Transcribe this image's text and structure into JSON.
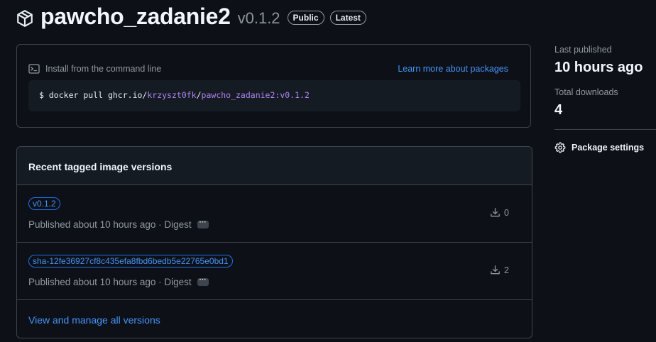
{
  "header": {
    "package_name": "pawcho_zadanie2",
    "version": "v0.1.2",
    "badges": [
      "Public",
      "Latest"
    ]
  },
  "install": {
    "title": "Install from the command line",
    "learn_more": "Learn more about packages",
    "prompt": "$",
    "cmd_prefix": "docker pull ghcr.io/",
    "cmd_owner": "krzyszt0fk",
    "cmd_sep": "/",
    "cmd_image": "pawcho_zadanie2:v0.1.2"
  },
  "versions": {
    "heading": "Recent tagged image versions",
    "rows": [
      {
        "tag": "v0.1.2",
        "published": "Published about 10 hours ago · Digest",
        "digest_button": "···",
        "downloads": "0"
      },
      {
        "tag": "sha-12fe36927cf8c435efa8fbd6bedb5e22765e0bd1",
        "published": "Published about 10 hours ago · Digest",
        "digest_button": "···",
        "downloads": "2"
      }
    ],
    "view_all": "View and manage all versions"
  },
  "sidebar": {
    "last_published_label": "Last published",
    "last_published_value": "10 hours ago",
    "total_downloads_label": "Total downloads",
    "total_downloads_value": "4",
    "settings_label": "Package settings"
  },
  "icons": {
    "package": "package-icon",
    "terminal": "terminal-icon",
    "download": "download-icon",
    "settings": "gear-icon"
  },
  "colors": {
    "background": "#0d1117",
    "link": "#4493f8",
    "border": "#3d444d",
    "muted_text": "#9198a1",
    "command_highlight": "#b083f0"
  }
}
